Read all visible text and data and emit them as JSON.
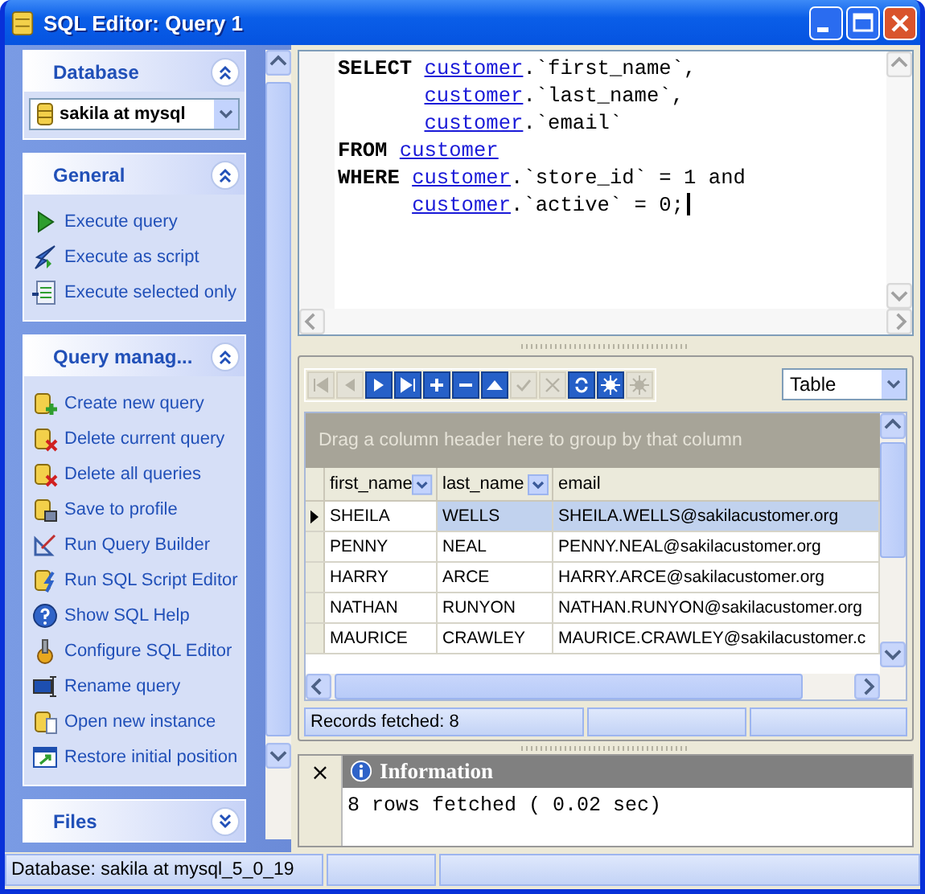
{
  "window": {
    "title": "SQL Editor: Query 1"
  },
  "sidebar": {
    "panels": [
      {
        "title": "Database",
        "expanded": true,
        "kind": "combo",
        "value": "sakila at mysql"
      },
      {
        "title": "General",
        "expanded": true,
        "kind": "links",
        "items": [
          "Execute query",
          "Execute as script",
          "Execute selected only"
        ]
      },
      {
        "title": "Query manag...",
        "expanded": true,
        "kind": "links",
        "items": [
          "Create new query",
          "Delete current query",
          "Delete all queries",
          "Save to profile",
          "Run Query Builder",
          "Run SQL Script Editor",
          "Show SQL Help",
          "Configure SQL Editor",
          "Rename query",
          "Open new instance",
          "Restore initial position"
        ]
      },
      {
        "title": "Files",
        "expanded": false
      }
    ]
  },
  "editor": {
    "lines": [
      {
        "tokens": [
          {
            "kind": "keyword",
            "text": "SELECT "
          },
          {
            "kind": "table",
            "text": "customer"
          },
          {
            "kind": "plain",
            "text": ".`first_name`,"
          }
        ]
      },
      {
        "continued": true,
        "tokens": [
          {
            "kind": "table",
            "text": "customer"
          },
          {
            "kind": "plain",
            "text": ".`last_name`,"
          }
        ]
      },
      {
        "continued": true,
        "tokens": [
          {
            "kind": "table",
            "text": "customer"
          },
          {
            "kind": "plain",
            "text": ".`email`"
          }
        ]
      },
      {
        "tokens": [
          {
            "kind": "keyword",
            "text": "FROM "
          },
          {
            "kind": "table",
            "text": "customer"
          }
        ]
      },
      {
        "tokens": [
          {
            "kind": "keyword",
            "text": "WHERE "
          },
          {
            "kind": "table",
            "text": "customer"
          },
          {
            "kind": "plain",
            "text": ".`store_id` = 1 and"
          }
        ]
      },
      {
        "continued": true,
        "tokens": [
          {
            "kind": "table",
            "text": "customer"
          },
          {
            "kind": "plain",
            "text": ".`active` = 0;"
          }
        ]
      }
    ]
  },
  "grid": {
    "toolbar": [
      {
        "disabled": true
      },
      {
        "disabled": true
      },
      {
        "disabled": false
      },
      {
        "disabled": false
      },
      {
        "disabled": false
      },
      {
        "disabled": false
      },
      {
        "disabled": false
      },
      {
        "disabled": true
      },
      {
        "disabled": true
      },
      {
        "disabled": false
      },
      {
        "disabled": false
      },
      {
        "disabled": true
      }
    ],
    "view_select": "Table",
    "group_hint": "Drag a column header here to group by that column",
    "columns": [
      {
        "label": "first_name",
        "dropdown": true
      },
      {
        "label": "last_name",
        "dropdown": true
      },
      {
        "label": "email",
        "dropdown": false
      }
    ],
    "rows": [
      {
        "selected": true,
        "cells": [
          "SHEILA",
          "WELLS",
          "SHEILA.WELLS@sakilacustomer.org"
        ]
      },
      {
        "selected": false,
        "cells": [
          "PENNY",
          "NEAL",
          "PENNY.NEAL@sakilacustomer.org"
        ]
      },
      {
        "selected": false,
        "cells": [
          "HARRY",
          "ARCE",
          "HARRY.ARCE@sakilacustomer.org"
        ]
      },
      {
        "selected": false,
        "cells": [
          "NATHAN",
          "RUNYON",
          "NATHAN.RUNYON@sakilacustomer.org"
        ]
      },
      {
        "selected": false,
        "cells": [
          "MAURICE",
          "CRAWLEY",
          "MAURICE.CRAWLEY@sakilacustomer.c"
        ]
      }
    ],
    "footer": "Records fetched: 8"
  },
  "info": {
    "close": "×",
    "title": "Information",
    "message": "8 rows fetched ( 0.02 sec)"
  },
  "status_bar": "Database: sakila at mysql_5_0_19"
}
